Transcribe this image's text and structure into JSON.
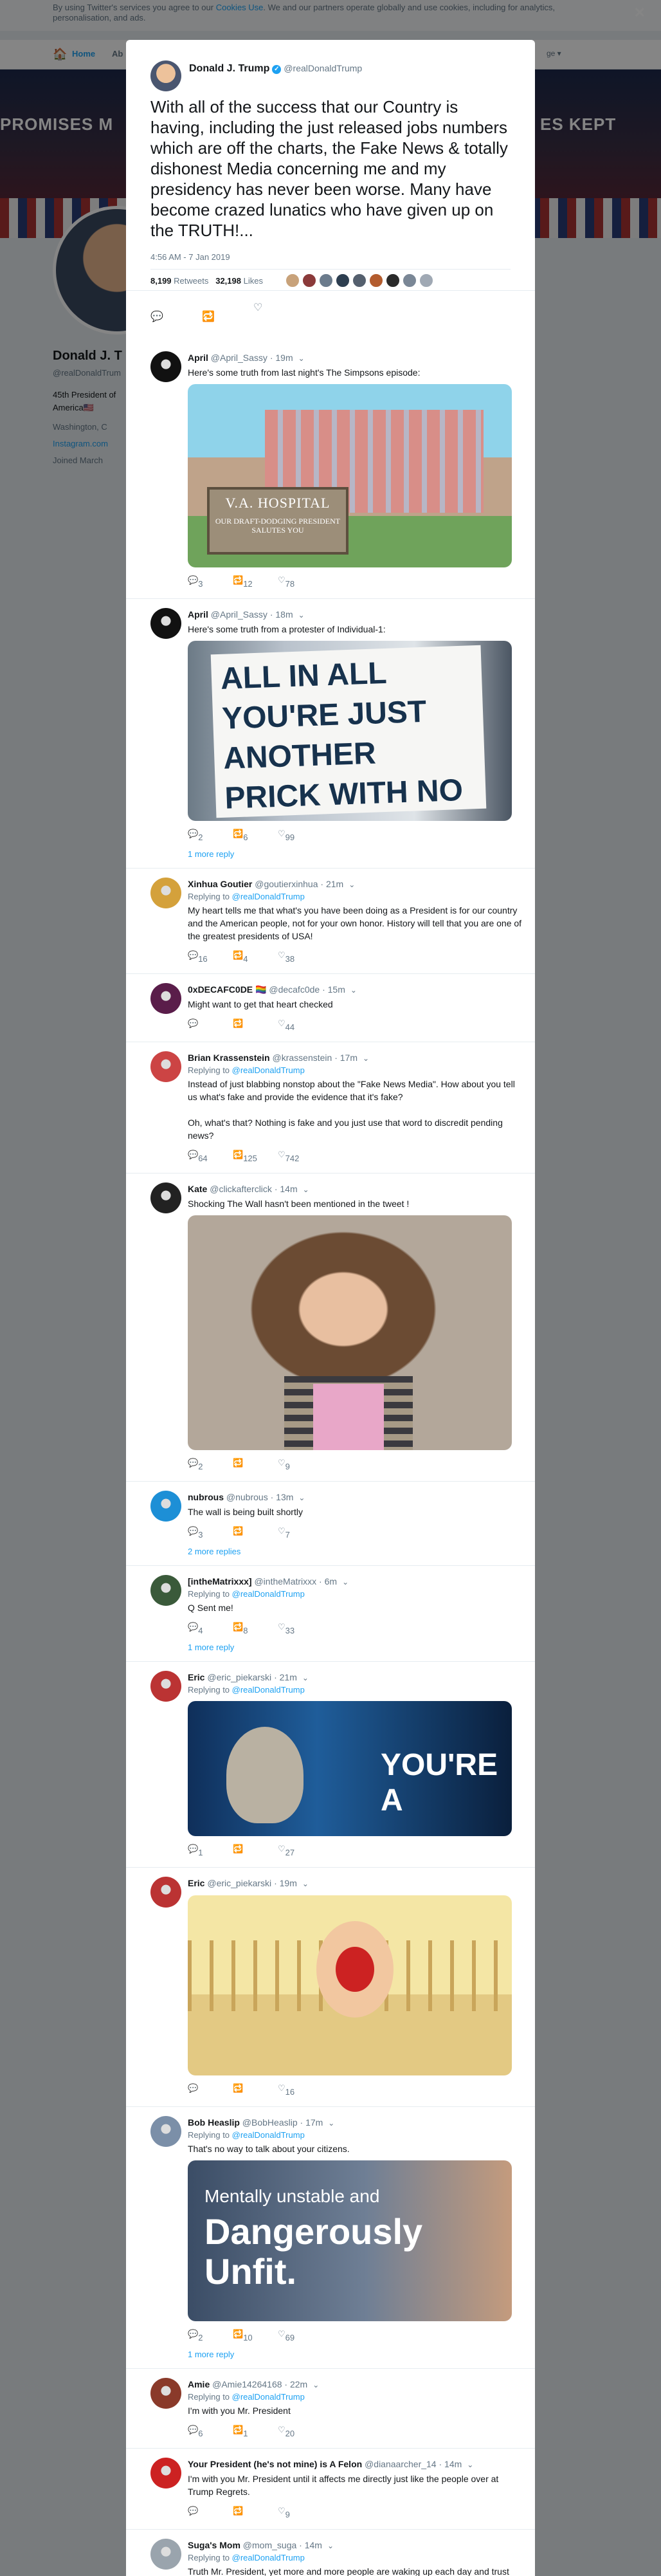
{
  "cookie": {
    "pre": "By using Twitter's services you agree to our ",
    "link": "Cookies Use",
    "post": ". We and our partners operate globally and use cookies, including for analytics, personalisation, and ads.",
    "close": "✕"
  },
  "nav": {
    "home": "Home",
    "about": "Ab",
    "lang": "ge ▾"
  },
  "banner": {
    "left": "PROMISES M",
    "right": "ES KEPT"
  },
  "profile": {
    "name": "Donald J. T",
    "handle": "@realDonaldTrum",
    "bio": "45th President of America🇺🇸",
    "location": "Washington, C",
    "website": "Instagram.com",
    "joined": "Joined March"
  },
  "tweet": {
    "name": "Donald J. Trump",
    "handle": "@realDonaldTrump",
    "text": "With all of the success that our Country is having, including the just released jobs numbers which are off the charts, the Fake News & totally dishonest Media concerning me and my presidency has never been worse. Many have become crazed lunatics who have given up on the TRUTH!...",
    "time": "4:56 AM - 7 Jan 2019",
    "retweets": "8,199",
    "retweets_label": "Retweets",
    "likes": "32,198",
    "likes_label": "Likes",
    "liker_colors": [
      "#c8a27a",
      "#8b3a3a",
      "#6b7b8c",
      "#2d3e50",
      "#55606e",
      "#b35c2e",
      "#2a2a2a",
      "#7a8796",
      "#a0a9b4"
    ]
  },
  "replies": [
    {
      "name": "April",
      "handle": "@April_Sassy",
      "time": "19m",
      "to": "",
      "text": "Here's some truth from last night's The Simpsons episode:",
      "media": "hospital",
      "media_text": {
        "s1": "V.A. HOSPITAL",
        "s2": "OUR DRAFT-DODGING PRESIDENT SALUTES YOU"
      },
      "replies": "3",
      "retweets": "12",
      "likes": "78",
      "more": "",
      "color": "#111"
    },
    {
      "name": "April",
      "handle": "@April_Sassy",
      "time": "18m",
      "to": "",
      "text": "Here's some truth from a protester of Individual-1:",
      "media": "sign",
      "media_text": {
        "s1": "ALL IN ALL YOU'RE JUST ANOTHER PRICK WITH NO WALL"
      },
      "replies": "2",
      "retweets": "6",
      "likes": "99",
      "more": "1 more reply",
      "color": "#111"
    },
    {
      "name": "Xinhua Goutier",
      "handle": "@goutierxinhua",
      "time": "21m",
      "to": "@realDonaldTrump",
      "text": "My heart tells me that what's you have been doing as a  President  is for our country and the American people, not for your own honor. History will tell that you are one of the greatest presidents of USA!",
      "media": "",
      "replies": "16",
      "retweets": "4",
      "likes": "38",
      "more": "",
      "color": "#d4a13b"
    },
    {
      "name": "0xDECAFC0DE 🏳️‍🌈",
      "handle": "@decafc0de",
      "time": "15m",
      "to": "",
      "text": "Might want to get that heart checked",
      "media": "",
      "replies": "",
      "retweets": "",
      "likes": "44",
      "more": "",
      "color": "#5a1d4a"
    },
    {
      "name": "Brian Krassenstein",
      "handle": "@krassenstein",
      "time": "17m",
      "to": "@realDonaldTrump",
      "text": "Instead of just blabbing nonstop about the \"Fake News Media\".  How about you tell us what's fake and provide the evidence that it's fake?\n\nOh, what's that?  Nothing is fake and you just use that word to discredit pending news?",
      "media": "",
      "replies": "64",
      "retweets": "125",
      "likes": "742",
      "more": "",
      "color": "#c44"
    },
    {
      "name": "Kate",
      "handle": "@clickafterclick",
      "time": "14m",
      "to": "",
      "text": "Shocking The Wall hasn't been mentioned in the tweet !",
      "media": "carrie",
      "replies": "2",
      "retweets": "",
      "likes": "9",
      "more": "",
      "color": "#222"
    },
    {
      "name": "nubrous",
      "handle": "@nubrous",
      "time": "13m",
      "to": "",
      "text": "The wall is being built shortly",
      "media": "",
      "replies": "3",
      "retweets": "",
      "likes": "7",
      "more": "2 more replies",
      "color": "#1d8fd6"
    },
    {
      "name": "[intheMatrixxx]",
      "handle": "@intheMatrixxx",
      "time": "6m",
      "to": "@realDonaldTrump",
      "text": "Q Sent me!",
      "media": "",
      "replies": "4",
      "retweets": "8",
      "likes": "33",
      "more": "1 more reply",
      "color": "#3a5a3a"
    },
    {
      "name": "Eric",
      "handle": "@eric_piekarski",
      "time": "21m",
      "to": "@realDonaldTrump",
      "text": "",
      "media": "gollum",
      "media_text": {
        "s1": "YOU'RE A"
      },
      "replies": "1",
      "retweets": "",
      "likes": "27",
      "more": "",
      "color": "#b33"
    },
    {
      "name": "Eric",
      "handle": "@eric_piekarski",
      "time": "19m",
      "to": "",
      "text": "",
      "media": "baby",
      "replies": "",
      "retweets": "",
      "likes": "16",
      "more": "",
      "color": "#b33"
    },
    {
      "name": "Bob Heaslip",
      "handle": "@BobHeaslip",
      "time": "17m",
      "to": "@realDonaldTrump",
      "text": "That's no way to talk about your citizens.",
      "media": "unfit",
      "media_text": {
        "s1": "Mentally unstable and",
        "s2": "Dangerously Unfit."
      },
      "replies": "2",
      "retweets": "10",
      "likes": "69",
      "more": "1 more reply",
      "color": "#7b8fa8"
    },
    {
      "name": "Amie",
      "handle": "@Amie14264168",
      "time": "22m",
      "to": "@realDonaldTrump",
      "text": "I'm with you Mr. President",
      "media": "",
      "replies": "6",
      "retweets": "1",
      "likes": "20",
      "more": "",
      "color": "#8a3a2a"
    },
    {
      "name": "Your President (he's not mine) is A Felon",
      "handle": "@dianaarcher_14",
      "time": "14m",
      "to": "",
      "text": "I'm with you Mr. President until it affects me directly just like the people over at Trump Regrets.",
      "media": "",
      "replies": "",
      "retweets": "",
      "likes": "9",
      "more": "",
      "color": "#c22"
    },
    {
      "name": "Suga's Mom",
      "handle": "@mom_suga",
      "time": "14m",
      "to": "@realDonaldTrump",
      "text": "Truth Mr. President, yet more and more people are waking up each day and trust You and \"trust the plan\" Thank Q 👍",
      "media": "",
      "replies": "",
      "retweets": "",
      "likes": "",
      "more": "",
      "color": "#9aa4ad"
    }
  ]
}
